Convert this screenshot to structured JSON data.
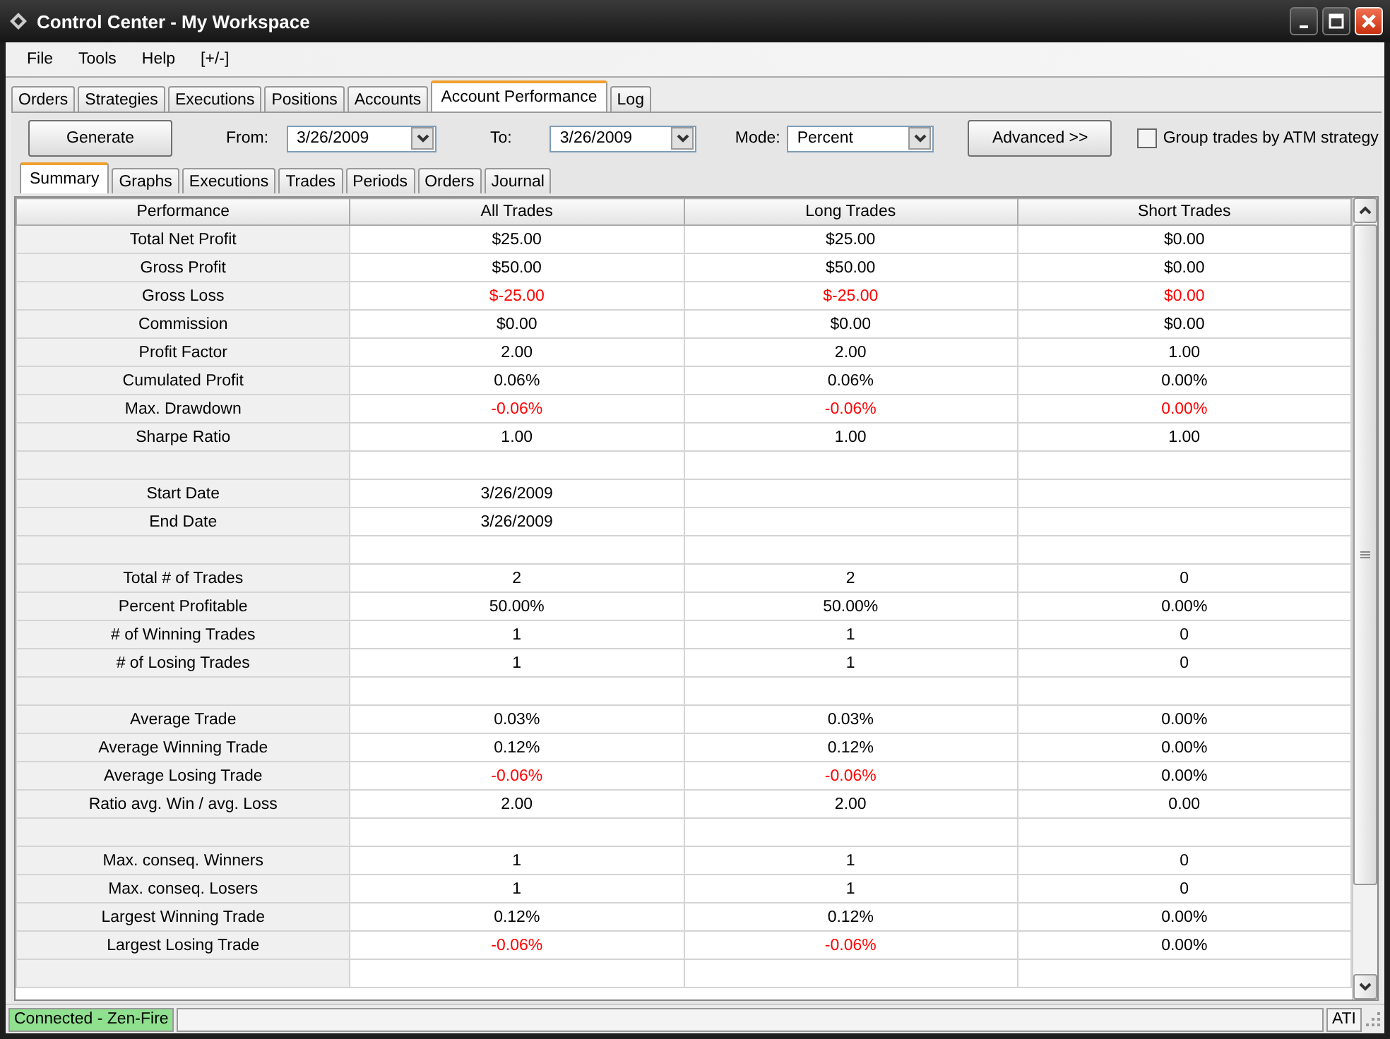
{
  "window": {
    "title": "Control Center - My Workspace"
  },
  "menu": [
    "File",
    "Tools",
    "Help",
    "[+/-]"
  ],
  "tabs": [
    {
      "label": "Orders",
      "selected": false
    },
    {
      "label": "Strategies",
      "selected": false
    },
    {
      "label": "Executions",
      "selected": false
    },
    {
      "label": "Positions",
      "selected": false
    },
    {
      "label": "Accounts",
      "selected": false
    },
    {
      "label": "Account Performance",
      "selected": true
    },
    {
      "label": "Log",
      "selected": false
    }
  ],
  "toolbar": {
    "generate_button": "Generate",
    "from": {
      "label": "From:",
      "value": "3/26/2009"
    },
    "to": {
      "label": "To:",
      "value": "3/26/2009"
    },
    "mode": {
      "label": "Mode:",
      "value": "Percent"
    },
    "advanced_button": "Advanced >>",
    "group_checkbox": {
      "label": "Group trades by ATM strategy",
      "checked": false
    }
  },
  "subtabs": [
    {
      "label": "Summary",
      "selected": true
    },
    {
      "label": "Graphs",
      "selected": false
    },
    {
      "label": "Executions",
      "selected": false
    },
    {
      "label": "Trades",
      "selected": false
    },
    {
      "label": "Periods",
      "selected": false
    },
    {
      "label": "Orders",
      "selected": false
    },
    {
      "label": "Journal",
      "selected": false
    }
  ],
  "table": {
    "columns": [
      "Performance",
      "All Trades",
      "Long Trades",
      "Short Trades"
    ],
    "rows": [
      {
        "kind": "data",
        "label": "Total Net Profit",
        "cells": [
          {
            "text": "$25.00",
            "negative": false
          },
          {
            "text": "$25.00",
            "negative": false
          },
          {
            "text": "$0.00",
            "negative": false
          }
        ]
      },
      {
        "kind": "data",
        "label": "Gross Profit",
        "cells": [
          {
            "text": "$50.00",
            "negative": false
          },
          {
            "text": "$50.00",
            "negative": false
          },
          {
            "text": "$0.00",
            "negative": false
          }
        ]
      },
      {
        "kind": "data",
        "label": "Gross Loss",
        "cells": [
          {
            "text": "$-25.00",
            "negative": true
          },
          {
            "text": "$-25.00",
            "negative": true
          },
          {
            "text": "$0.00",
            "negative": true
          }
        ]
      },
      {
        "kind": "data",
        "label": "Commission",
        "cells": [
          {
            "text": "$0.00",
            "negative": false
          },
          {
            "text": "$0.00",
            "negative": false
          },
          {
            "text": "$0.00",
            "negative": false
          }
        ]
      },
      {
        "kind": "data",
        "label": "Profit Factor",
        "cells": [
          {
            "text": "2.00",
            "negative": false
          },
          {
            "text": "2.00",
            "negative": false
          },
          {
            "text": "1.00",
            "negative": false
          }
        ]
      },
      {
        "kind": "data",
        "label": "Cumulated Profit",
        "cells": [
          {
            "text": "0.06%",
            "negative": false
          },
          {
            "text": "0.06%",
            "negative": false
          },
          {
            "text": "0.00%",
            "negative": false
          }
        ]
      },
      {
        "kind": "data",
        "label": "Max. Drawdown",
        "cells": [
          {
            "text": "-0.06%",
            "negative": true
          },
          {
            "text": "-0.06%",
            "negative": true
          },
          {
            "text": "0.00%",
            "negative": true
          }
        ]
      },
      {
        "kind": "data",
        "label": "Sharpe Ratio",
        "cells": [
          {
            "text": "1.00",
            "negative": false
          },
          {
            "text": "1.00",
            "negative": false
          },
          {
            "text": "1.00",
            "negative": false
          }
        ]
      },
      {
        "kind": "blank"
      },
      {
        "kind": "data",
        "label": "Start Date",
        "cells": [
          {
            "text": "3/26/2009",
            "negative": false
          }
        ]
      },
      {
        "kind": "data",
        "label": "End Date",
        "cells": [
          {
            "text": "3/26/2009",
            "negative": false
          }
        ]
      },
      {
        "kind": "blank"
      },
      {
        "kind": "data",
        "label": "Total # of Trades",
        "cells": [
          {
            "text": "2",
            "negative": false
          },
          {
            "text": "2",
            "negative": false
          },
          {
            "text": "0",
            "negative": false
          }
        ]
      },
      {
        "kind": "data",
        "label": "Percent Profitable",
        "cells": [
          {
            "text": "50.00%",
            "negative": false
          },
          {
            "text": "50.00%",
            "negative": false
          },
          {
            "text": "0.00%",
            "negative": false
          }
        ]
      },
      {
        "kind": "data",
        "label": "# of Winning Trades",
        "cells": [
          {
            "text": "1",
            "negative": false
          },
          {
            "text": "1",
            "negative": false
          },
          {
            "text": "0",
            "negative": false
          }
        ]
      },
      {
        "kind": "data",
        "label": "# of Losing Trades",
        "cells": [
          {
            "text": "1",
            "negative": false
          },
          {
            "text": "1",
            "negative": false
          },
          {
            "text": "0",
            "negative": false
          }
        ]
      },
      {
        "kind": "blank"
      },
      {
        "kind": "data",
        "label": "Average Trade",
        "cells": [
          {
            "text": "0.03%",
            "negative": false
          },
          {
            "text": "0.03%",
            "negative": false
          },
          {
            "text": "0.00%",
            "negative": false
          }
        ]
      },
      {
        "kind": "data",
        "label": "Average Winning Trade",
        "cells": [
          {
            "text": "0.12%",
            "negative": false
          },
          {
            "text": "0.12%",
            "negative": false
          },
          {
            "text": "0.00%",
            "negative": false
          }
        ]
      },
      {
        "kind": "data",
        "label": "Average Losing Trade",
        "cells": [
          {
            "text": "-0.06%",
            "negative": true
          },
          {
            "text": "-0.06%",
            "negative": true
          },
          {
            "text": "0.00%",
            "negative": false
          }
        ]
      },
      {
        "kind": "data",
        "label": "Ratio avg. Win / avg. Loss",
        "cells": [
          {
            "text": "2.00",
            "negative": false
          },
          {
            "text": "2.00",
            "negative": false
          },
          {
            "text": "0.00",
            "negative": false
          }
        ]
      },
      {
        "kind": "blank"
      },
      {
        "kind": "data",
        "label": "Max. conseq. Winners",
        "cells": [
          {
            "text": "1",
            "negative": false
          },
          {
            "text": "1",
            "negative": false
          },
          {
            "text": "0",
            "negative": false
          }
        ]
      },
      {
        "kind": "data",
        "label": "Max. conseq. Losers",
        "cells": [
          {
            "text": "1",
            "negative": false
          },
          {
            "text": "1",
            "negative": false
          },
          {
            "text": "0",
            "negative": false
          }
        ]
      },
      {
        "kind": "data",
        "label": "Largest Winning Trade",
        "cells": [
          {
            "text": "0.12%",
            "negative": false
          },
          {
            "text": "0.12%",
            "negative": false
          },
          {
            "text": "0.00%",
            "negative": false
          }
        ]
      },
      {
        "kind": "data",
        "label": "Largest Losing Trade",
        "cells": [
          {
            "text": "-0.06%",
            "negative": true
          },
          {
            "text": "-0.06%",
            "negative": true
          },
          {
            "text": "0.00%",
            "negative": false
          }
        ]
      },
      {
        "kind": "blank"
      }
    ]
  },
  "status_bar": {
    "connection": {
      "text": "Connected - Zen-Fire",
      "connected": true
    },
    "provider": "ATI"
  }
}
